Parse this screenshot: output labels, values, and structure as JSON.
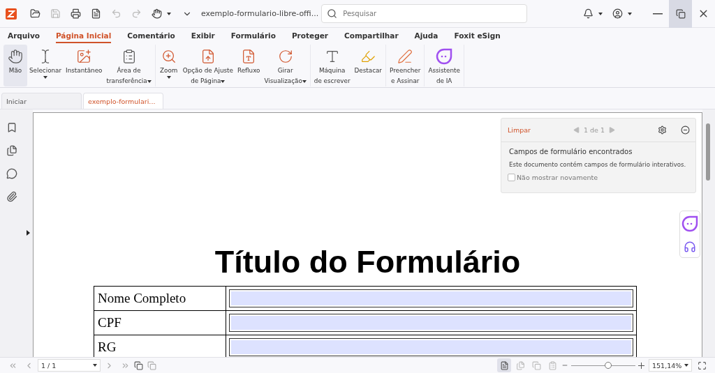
{
  "title_bar": {
    "document_name": "exemplo-formulario-libre-offi...",
    "search": {
      "placeholder": "Pesquisar"
    }
  },
  "menu_tabs": [
    {
      "label": "Arquivo",
      "selected": false
    },
    {
      "label": "Página Inicial",
      "selected": true
    },
    {
      "label": "Comentário",
      "selected": false
    },
    {
      "label": "Exibir",
      "selected": false
    },
    {
      "label": "Formulário",
      "selected": false
    },
    {
      "label": "Proteger",
      "selected": false
    },
    {
      "label": "Compartilhar",
      "selected": false
    },
    {
      "label": "Ajuda",
      "selected": false
    },
    {
      "label": "Foxit eSign",
      "selected": false
    }
  ],
  "ribbon": {
    "groups": [
      {
        "items": [
          {
            "lines": [
              "Mão"
            ],
            "dropdown": false,
            "selected": true
          },
          {
            "lines": [
              "Selecionar"
            ],
            "dropdown": true,
            "selected": false
          },
          {
            "lines": [
              "Instantâneo"
            ],
            "dropdown": false,
            "selected": false
          },
          {
            "lines": [
              "Área de",
              "transferência"
            ],
            "dropdown": true,
            "selected": false
          }
        ]
      },
      {
        "items": [
          {
            "lines": [
              "Zoom"
            ],
            "dropdown": true,
            "selected": false
          },
          {
            "lines": [
              "Opção de Ajuste",
              "de Página"
            ],
            "dropdown": true,
            "selected": false
          },
          {
            "lines": [
              "Refluxo"
            ],
            "dropdown": false,
            "selected": false
          },
          {
            "lines": [
              "Girar",
              "Visualização"
            ],
            "dropdown": true,
            "selected": false
          }
        ]
      },
      {
        "items": [
          {
            "lines": [
              "Máquina",
              "de escrever"
            ],
            "dropdown": false,
            "selected": false
          },
          {
            "lines": [
              "Destacar"
            ],
            "dropdown": false,
            "selected": false
          }
        ]
      },
      {
        "items": [
          {
            "lines": [
              "Preencher",
              "e Assinar"
            ],
            "dropdown": false,
            "selected": false
          }
        ]
      },
      {
        "items": [
          {
            "lines": [
              "Assistente",
              "de IA"
            ],
            "dropdown": false,
            "selected": false
          }
        ]
      }
    ]
  },
  "doc_tabs": [
    {
      "label": "Iniciar",
      "selected": false
    },
    {
      "label": "exemplo-formulari...",
      "selected": true
    }
  ],
  "form_panel": {
    "clear": "Limpar",
    "pager": "1 de 1",
    "heading": "Campos de formulário encontrados",
    "message": "Este documento contém campos de formulário interativos.",
    "dont_show": {
      "label": "Não mostrar novamente",
      "checked": false
    }
  },
  "document": {
    "title": "Título do Formulário",
    "rows": [
      {
        "label": "Nome Completo"
      },
      {
        "label": "CPF"
      },
      {
        "label": "RG"
      }
    ]
  },
  "status_bar": {
    "page": "1 / 1",
    "view_modes": [
      {
        "selected": true
      },
      {
        "selected": false
      },
      {
        "selected": false
      },
      {
        "selected": false
      }
    ],
    "zoom_slider": {
      "level": 0.58
    },
    "zoom": "151,14%"
  }
}
